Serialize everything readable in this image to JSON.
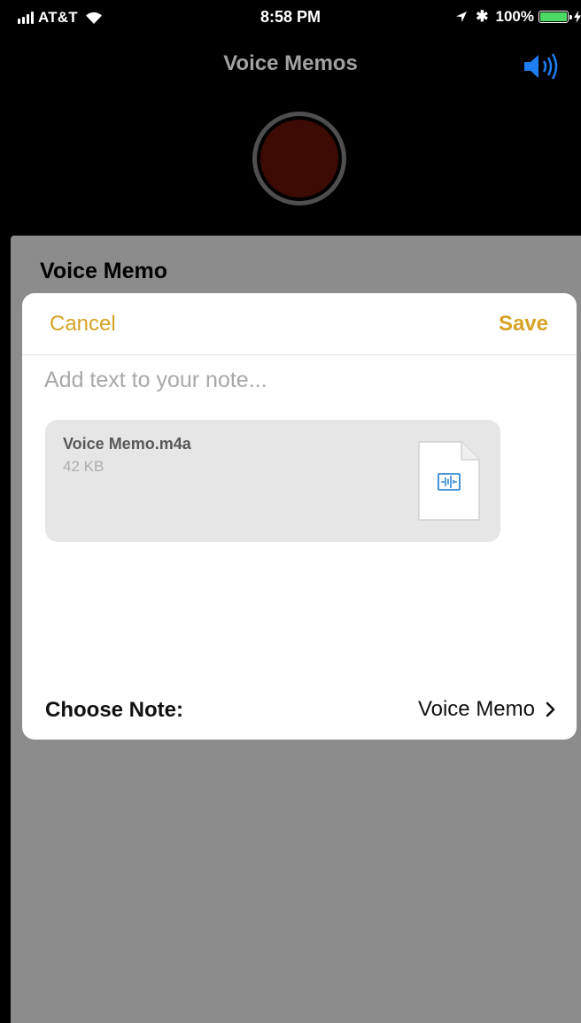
{
  "status_bar": {
    "carrier": "AT&T",
    "time": "8:58 PM",
    "battery": "100%",
    "icons": [
      "signal-icon",
      "wifi-icon",
      "location-icon",
      "bluetooth-icon",
      "battery-icon",
      "charging-icon"
    ]
  },
  "header": {
    "title": "Voice Memos",
    "speaker_icon": "speaker-icon",
    "record_icon": "record-icon"
  },
  "share_sheet": {
    "title": "Voice Memo",
    "cancel_label": "Cancel",
    "save_label": "Save",
    "note_placeholder": "Add text to your note...",
    "attachment": {
      "name": "Voice Memo.m4a",
      "size": "42 KB",
      "icon": "audio-file-icon"
    },
    "choose_note": {
      "label": "Choose Note:",
      "value": "Voice Memo",
      "chevron_icon": "chevron-right-icon"
    }
  },
  "colors": {
    "accent": "#d6a323",
    "battery_green": "#4cd964",
    "speaker_blue": "#1e7ef2",
    "record_red": "#3b0b04"
  }
}
